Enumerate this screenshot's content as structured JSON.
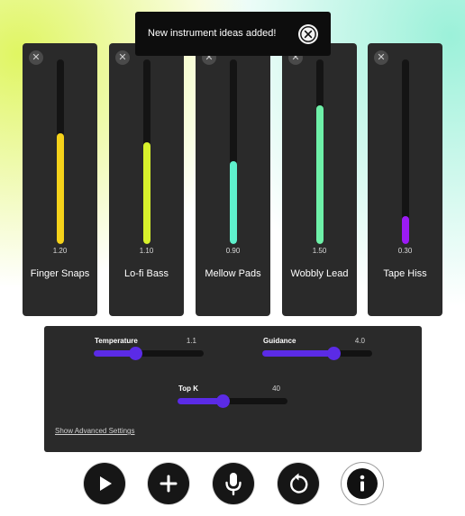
{
  "toast": {
    "message": "New instrument ideas added!"
  },
  "prompts": [
    {
      "name": "Finger Snaps",
      "weight": "1.20",
      "level": 1.2,
      "color": "#f5d21a"
    },
    {
      "name": "Lo-fi Bass",
      "weight": "1.10",
      "level": 1.1,
      "color": "#d8f22c"
    },
    {
      "name": "Mellow Pads",
      "weight": "0.90",
      "level": 0.9,
      "color": "#5ef0cc"
    },
    {
      "name": "Wobbly Lead",
      "weight": "1.50",
      "level": 1.5,
      "color": "#6ef0a8"
    },
    {
      "name": "Tape Hiss",
      "weight": "0.30",
      "level": 0.3,
      "color": "#9b1bf5"
    }
  ],
  "prompt_weight_max": 2.0,
  "settings": {
    "temperature": {
      "label": "Temperature",
      "value": "1.1",
      "fraction": 0.38
    },
    "guidance": {
      "label": "Guidance",
      "value": "4.0",
      "fraction": 0.65
    },
    "top_k": {
      "label": "Top K",
      "value": "40",
      "fraction": 0.41
    },
    "advanced_link": "Show Advanced Settings"
  },
  "accent_color": "#5b2be6",
  "buttons": [
    "play-icon",
    "plus-icon",
    "microphone-icon",
    "reset-icon",
    "info-icon"
  ]
}
